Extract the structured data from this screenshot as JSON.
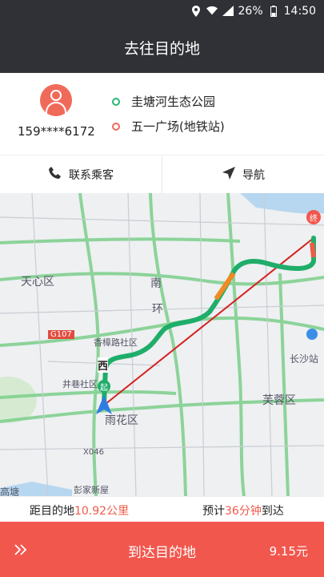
{
  "status_bar": {
    "battery": "26%",
    "time": "14:50",
    "network": "4G"
  },
  "header": {
    "title": "去往目的地"
  },
  "passenger": {
    "phone": "159****6172",
    "origin": "圭塘河生态公园",
    "destination": "五一广场(地铁站)"
  },
  "actions": {
    "contact": "联系乘客",
    "navigate": "导航"
  },
  "map": {
    "labels": {
      "tianxin": "天心区",
      "g107": "G107",
      "xiangzhang": "香樟路社区",
      "jingxiang": "井巷社区",
      "yuhua": "雨花区",
      "furong": "芙蓉区",
      "changsha": "长沙站",
      "nan": "南",
      "huan": "环",
      "x046": "X046",
      "pengjia": "彭家新屋",
      "gaoqiao": "高塘",
      "xi": "西",
      "qi": "起",
      "zhong": "终"
    }
  },
  "info": {
    "dist_prefix": "距目的地",
    "dist_value": "10.92公里",
    "eta_prefix": "预计",
    "eta_value": "36分钟",
    "eta_suffix": "到达"
  },
  "arrive": {
    "label": "到达目的地",
    "price": "9.15元"
  },
  "colors": {
    "header": "#2f3136",
    "accent": "#f2574e",
    "route": "#1fae6a"
  }
}
